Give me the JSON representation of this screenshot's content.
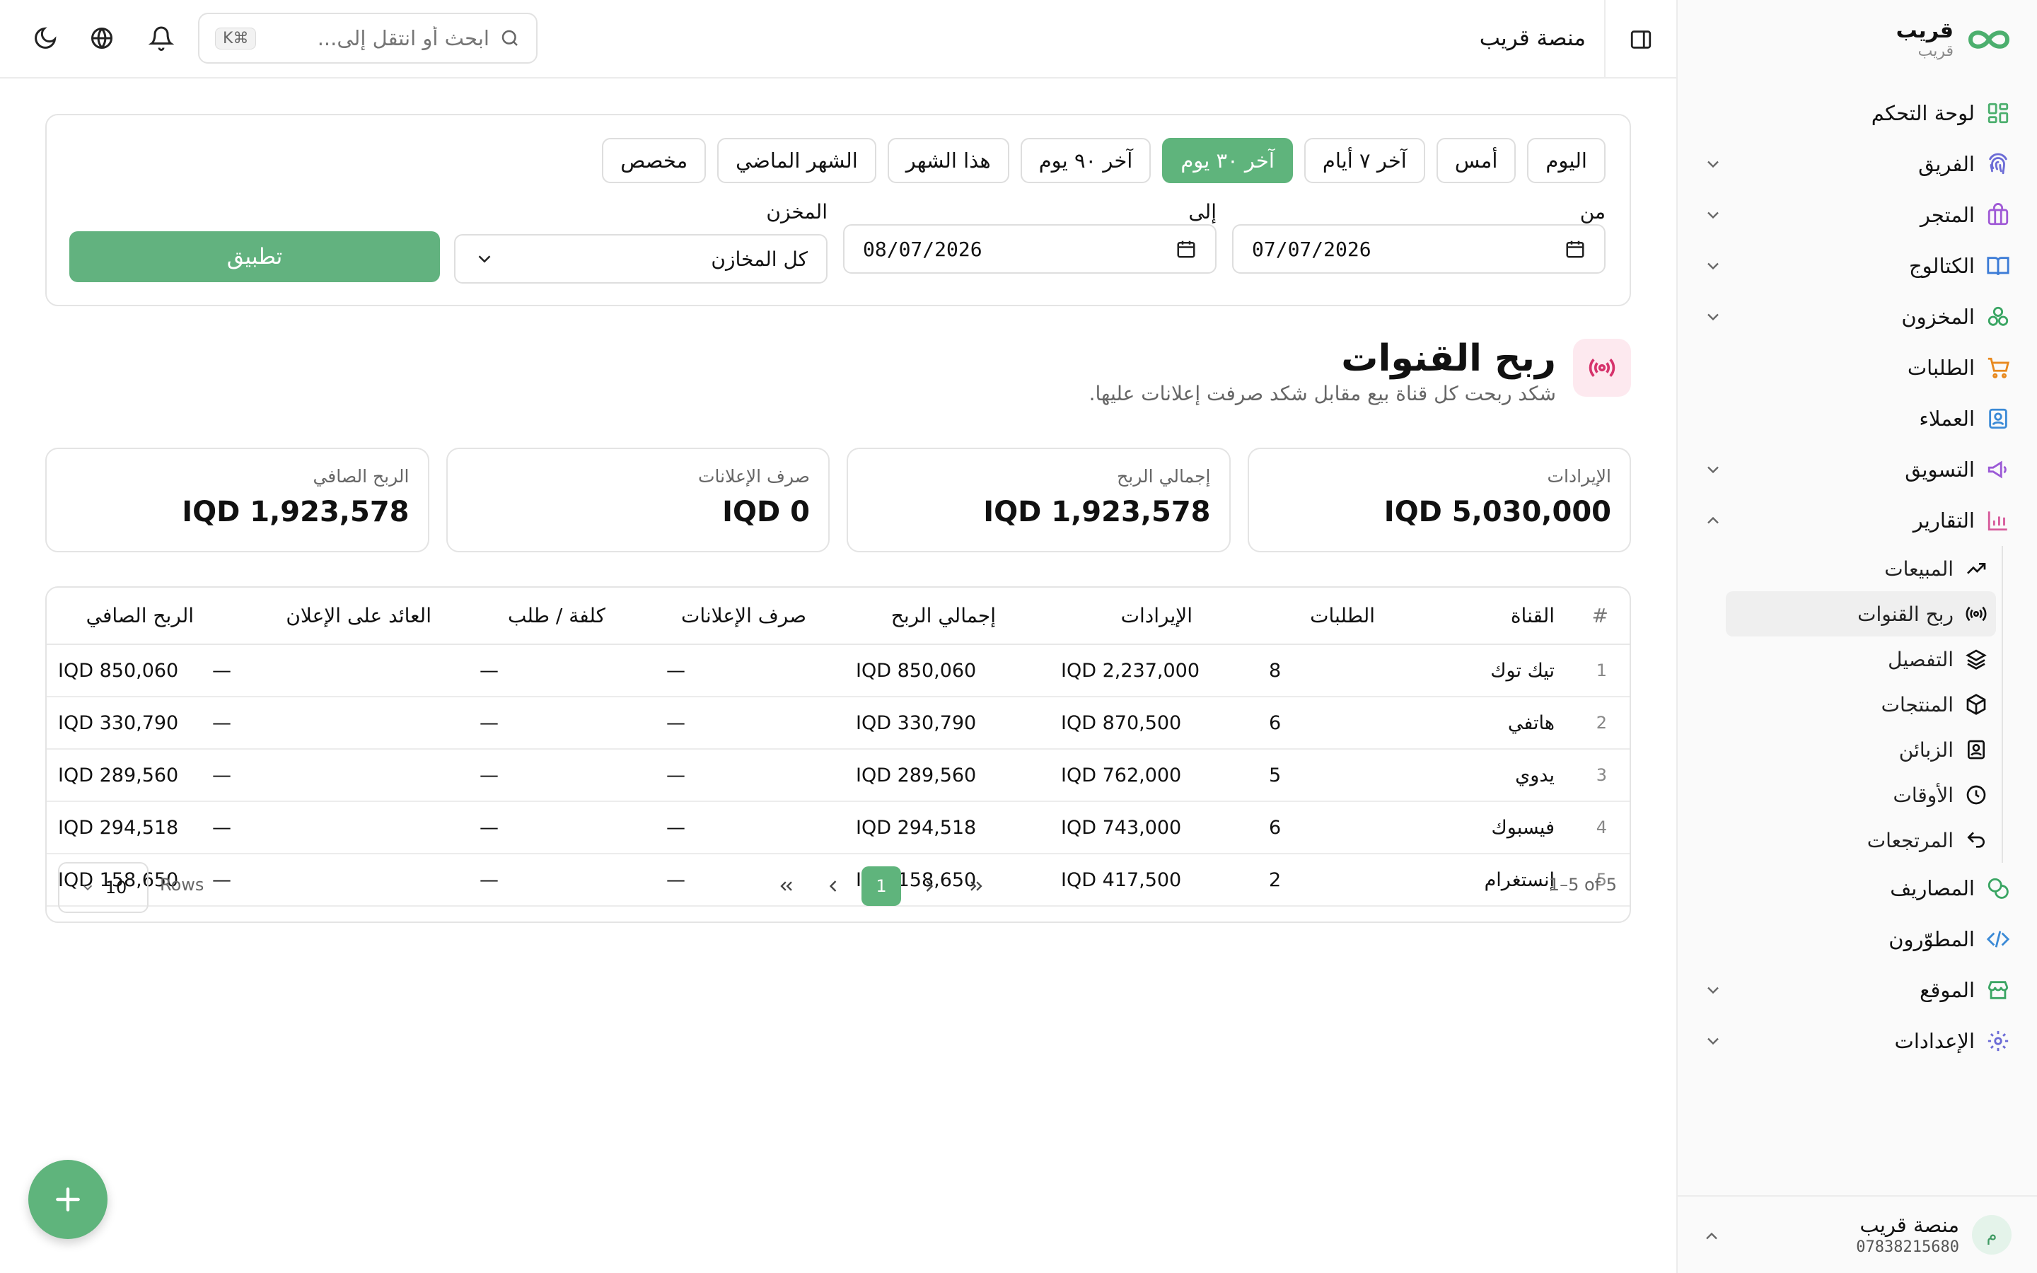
{
  "brand": {
    "name": "قريب",
    "subtitle": "قريب"
  },
  "sidebar": {
    "items": [
      {
        "label": "لوحة التحكم",
        "icon": "dashboard-icon",
        "color": "#4caf6e"
      },
      {
        "label": "الفريق",
        "icon": "fingerprint-icon",
        "color": "#6b6bd6",
        "chevron": "down"
      },
      {
        "label": "المتجر",
        "icon": "store-icon",
        "color": "#a05ad6",
        "chevron": "down"
      },
      {
        "label": "الكتالوج",
        "icon": "book-icon",
        "color": "#3b7bd6",
        "chevron": "down"
      },
      {
        "label": "المخزون",
        "icon": "inventory-icon",
        "color": "#3aa563",
        "chevron": "down"
      },
      {
        "label": "الطلبات",
        "icon": "cart-icon",
        "color": "#e8891e"
      },
      {
        "label": "العملاء",
        "icon": "contact-icon",
        "color": "#3b8ad6"
      },
      {
        "label": "التسويق",
        "icon": "megaphone-icon",
        "color": "#9b59d6",
        "chevron": "down"
      },
      {
        "label": "التقارير",
        "icon": "bar-chart-icon",
        "color": "#d65a9b",
        "chevron": "up"
      }
    ],
    "report_sub_items": [
      {
        "label": "المبيعات",
        "icon": "trend-up-icon"
      },
      {
        "label": "ربح القنوات",
        "icon": "broadcast-icon",
        "active": true
      },
      {
        "label": "التفصيل",
        "icon": "layers-icon"
      },
      {
        "label": "المنتجات",
        "icon": "box-icon"
      },
      {
        "label": "الزبائن",
        "icon": "customer-card-icon"
      },
      {
        "label": "الأوقات",
        "icon": "clock-icon"
      },
      {
        "label": "المرتجعات",
        "icon": "undo-icon"
      }
    ],
    "items_after": [
      {
        "label": "المصاريف",
        "icon": "coins-icon",
        "color": "#3aa563"
      },
      {
        "label": "المطوّرون",
        "icon": "code-icon",
        "color": "#3b8ad6"
      },
      {
        "label": "الموقع",
        "icon": "storefront-icon",
        "color": "#3aa563",
        "chevron": "down"
      },
      {
        "label": "الإعدادات",
        "icon": "gear-icon",
        "color": "#6b6bd6",
        "chevron": "down"
      }
    ],
    "user": {
      "name": "منصة قريب",
      "phone": "07838215680",
      "initial": "م"
    }
  },
  "topbar": {
    "title": "منصة قريب",
    "search_placeholder": "ابحث أو انتقل إلى...",
    "search_shortcut": "⌘K"
  },
  "filters": {
    "presets": [
      "اليوم",
      "أمس",
      "آخر ٧ أيام",
      "آخر ٣٠ يوم",
      "آخر ٩٠ يوم",
      "هذا الشهر",
      "الشهر الماضي",
      "مخصص"
    ],
    "active_preset": "آخر ٣٠ يوم",
    "from_label": "من",
    "from_value": "07/07/2026",
    "to_label": "إلى",
    "to_value": "08/07/2026",
    "warehouse_label": "المخزن",
    "warehouse_value": "كل المخازن",
    "apply_label": "تطبيق"
  },
  "section": {
    "title": "ربح القنوات",
    "subtitle": "شكد ربحت كل قناة بيع مقابل شكد صرفت إعلانات عليها."
  },
  "stats": [
    {
      "label": "الإيرادات",
      "value": "IQD 5,030,000"
    },
    {
      "label": "إجمالي الربح",
      "value": "IQD 1,923,578"
    },
    {
      "label": "صرف الإعلانات",
      "value": "IQD 0"
    },
    {
      "label": "الربح الصافي",
      "value": "IQD 1,923,578"
    }
  ],
  "table": {
    "columns": [
      "#",
      "القناة",
      "الطلبات",
      "الإيرادات",
      "إجمالي الربح",
      "صرف الإعلانات",
      "كلفة / طلب",
      "العائد على الإعلان",
      "الربح الصافي"
    ],
    "rows": [
      [
        "1",
        "تيك توك",
        "8",
        "IQD 2,237,000",
        "IQD 850,060",
        "—",
        "—",
        "—",
        "IQD 850,060"
      ],
      [
        "2",
        "هاتفي",
        "6",
        "IQD 870,500",
        "IQD 330,790",
        "—",
        "—",
        "—",
        "IQD 330,790"
      ],
      [
        "3",
        "يدوي",
        "5",
        "IQD 762,000",
        "IQD 289,560",
        "—",
        "—",
        "—",
        "IQD 289,560"
      ],
      [
        "4",
        "فيسبوك",
        "6",
        "IQD 743,000",
        "IQD 294,518",
        "—",
        "—",
        "—",
        "IQD 294,518"
      ],
      [
        "5",
        "إنستغرام",
        "2",
        "IQD 417,500",
        "IQD 158,650",
        "—",
        "—",
        "—",
        "IQD 158,650"
      ]
    ]
  },
  "pagination": {
    "range": "1–5 of 5",
    "current_page": "1",
    "rows_label": "Rows",
    "rows_value": "10"
  },
  "colors": {
    "accent": "#5fb47c",
    "border": "#e4e4e4",
    "muted_text": "#666666"
  }
}
